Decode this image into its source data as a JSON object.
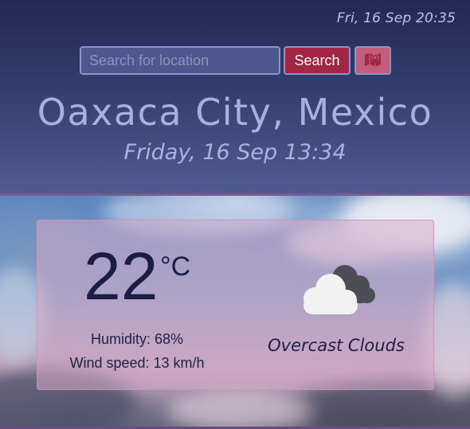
{
  "header": {
    "clock": "Fri, 16 Sep 20:35",
    "city": "Oaxaca City, Mexico",
    "local_date": "Friday, 16 Sep 13:34"
  },
  "search": {
    "placeholder": "Search for location",
    "value": "",
    "button_label": "Search",
    "map_button_icon": "map-icon"
  },
  "weather": {
    "temperature": "22",
    "unit": "°C",
    "humidity": "Humidity: 68%",
    "wind_speed": "Wind speed: 13 km/h",
    "condition": "Overcast Clouds",
    "icon": "overcast-clouds-icon"
  },
  "colors": {
    "header_bg_top": "#222a53",
    "header_bg_bottom": "#505b91",
    "search_button": "#a32744",
    "map_button": "#c25e7b",
    "title_text": "#a7b1e1",
    "card_text": "#1b1d45"
  }
}
